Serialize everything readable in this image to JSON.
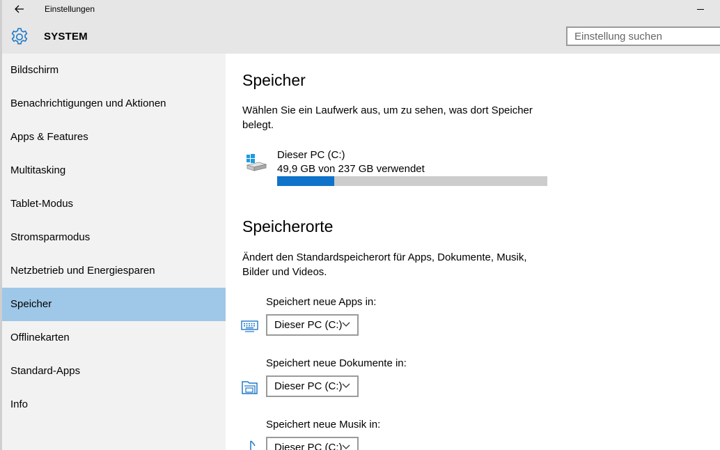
{
  "window": {
    "title": "Einstellungen"
  },
  "header": {
    "section_title": "SYSTEM",
    "search_placeholder": "Einstellung suchen"
  },
  "sidebar": {
    "items": [
      {
        "label": "Bildschirm",
        "selected": false
      },
      {
        "label": "Benachrichtigungen und Aktionen",
        "selected": false
      },
      {
        "label": "Apps & Features",
        "selected": false
      },
      {
        "label": "Multitasking",
        "selected": false
      },
      {
        "label": "Tablet-Modus",
        "selected": false
      },
      {
        "label": "Stromsparmodus",
        "selected": false
      },
      {
        "label": "Netzbetrieb und Energiesparen",
        "selected": false
      },
      {
        "label": "Speicher",
        "selected": true
      },
      {
        "label": "Offlinekarten",
        "selected": false
      },
      {
        "label": "Standard-Apps",
        "selected": false
      },
      {
        "label": "Info",
        "selected": false
      }
    ]
  },
  "storage": {
    "title": "Speicher",
    "description": "Wählen Sie ein Laufwerk aus, um zu sehen, was dort Speicher belegt.",
    "drive": {
      "name": "Dieser PC (C:)",
      "usage": "49,9 GB von 237 GB verwendet",
      "used_fraction": 0.2105,
      "icon": "drive-icon"
    }
  },
  "locations": {
    "title": "Speicherorte",
    "description": "Ändert den Standardspeicherort für Apps, Dokumente, Musik, Bilder und Videos.",
    "items": [
      {
        "label": "Speichert neue Apps in:",
        "value": "Dieser PC (C:)",
        "icon": "apps-icon"
      },
      {
        "label": "Speichert neue Dokumente in:",
        "value": "Dieser PC (C:)",
        "icon": "documents-icon"
      },
      {
        "label": "Speichert neue Musik in:",
        "value": "Dieser PC (C:)",
        "icon": "music-icon"
      }
    ]
  },
  "colors": {
    "accent": "#0f73c9",
    "selection": "#9ec7e8",
    "header_bg": "#e6e6e6",
    "sidebar_bg": "#f2f2f2"
  }
}
